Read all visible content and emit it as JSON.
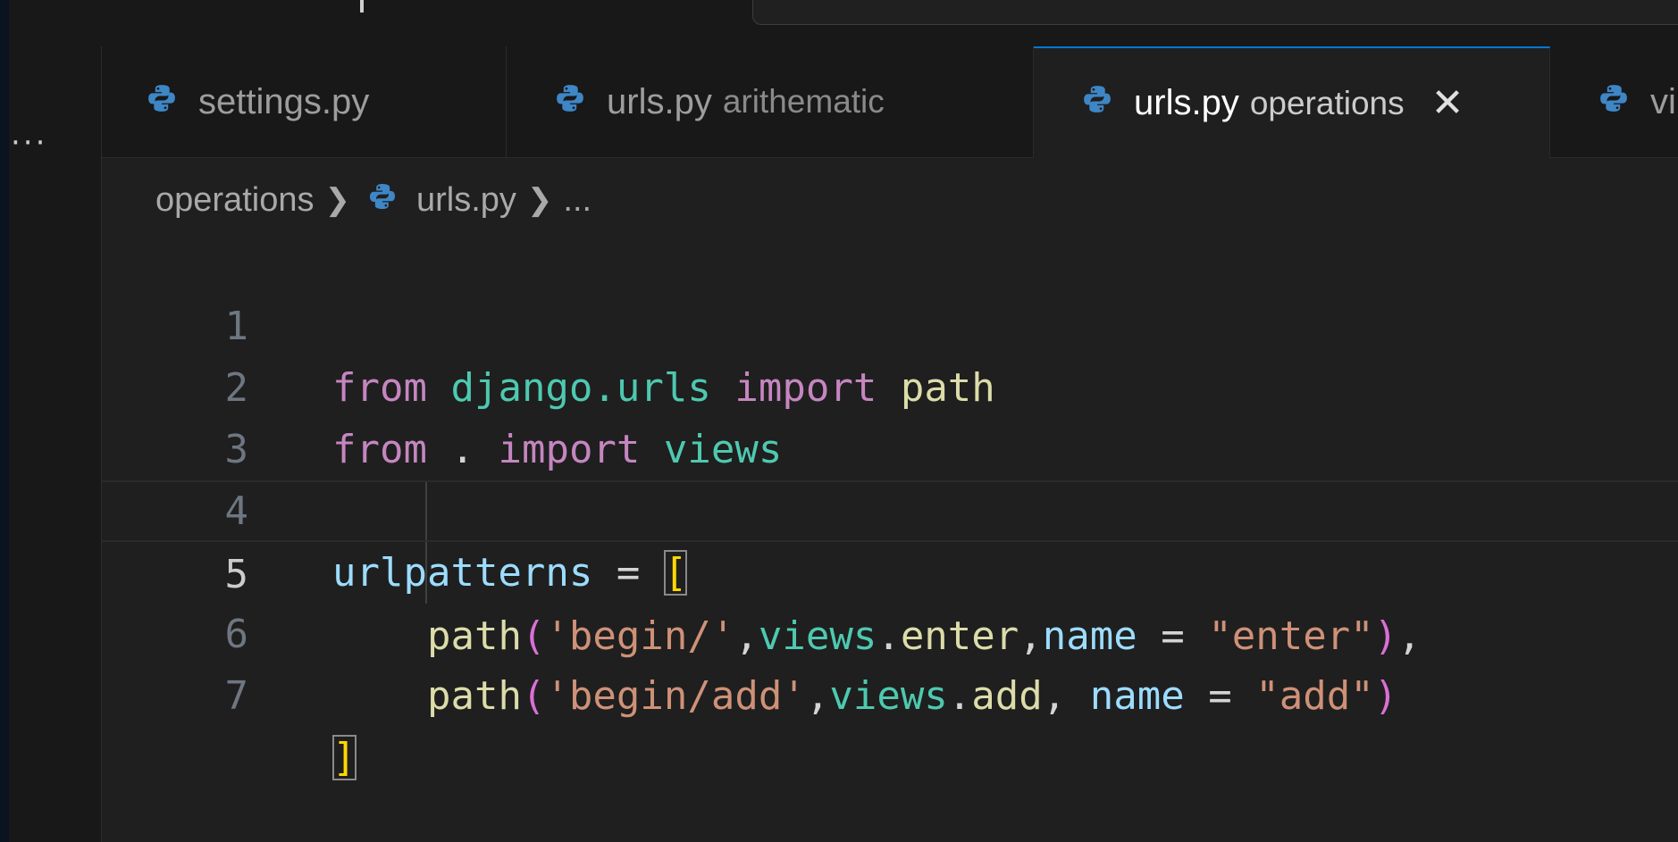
{
  "tabs": [
    {
      "name": "settings.py",
      "description": "",
      "active": false
    },
    {
      "name": "urls.py",
      "description": "arithematic",
      "active": false
    },
    {
      "name": "urls.py",
      "description": "operations",
      "active": true,
      "close": "✕"
    },
    {
      "name": "vi",
      "description": "",
      "active": false
    }
  ],
  "more_icon": "···",
  "breadcrumb": {
    "folder": "operations",
    "file": "urls.py",
    "ellipsis": "..."
  },
  "editor": {
    "current_line": 5,
    "line_numbers": [
      "1",
      "2",
      "3",
      "4",
      "5",
      "6",
      "7"
    ],
    "lines": [
      "from django.urls import path",
      "from . import views",
      "",
      "urlpatterns = [",
      "    path('begin/',views.enter,name = \"enter\"),",
      "    path('begin/add',views.add, name = \"add\")",
      "]"
    ]
  },
  "colors": {
    "keyword": "#c586c0",
    "module": "#4ec9b0",
    "function": "#dcdcaa",
    "variable": "#9cdcfe",
    "string": "#ce9178",
    "bracket_level1": "#ffd700",
    "bracket_level2": "#da70d6",
    "active_tab_border": "#0078d4",
    "python_icon": "#3e86c6"
  }
}
